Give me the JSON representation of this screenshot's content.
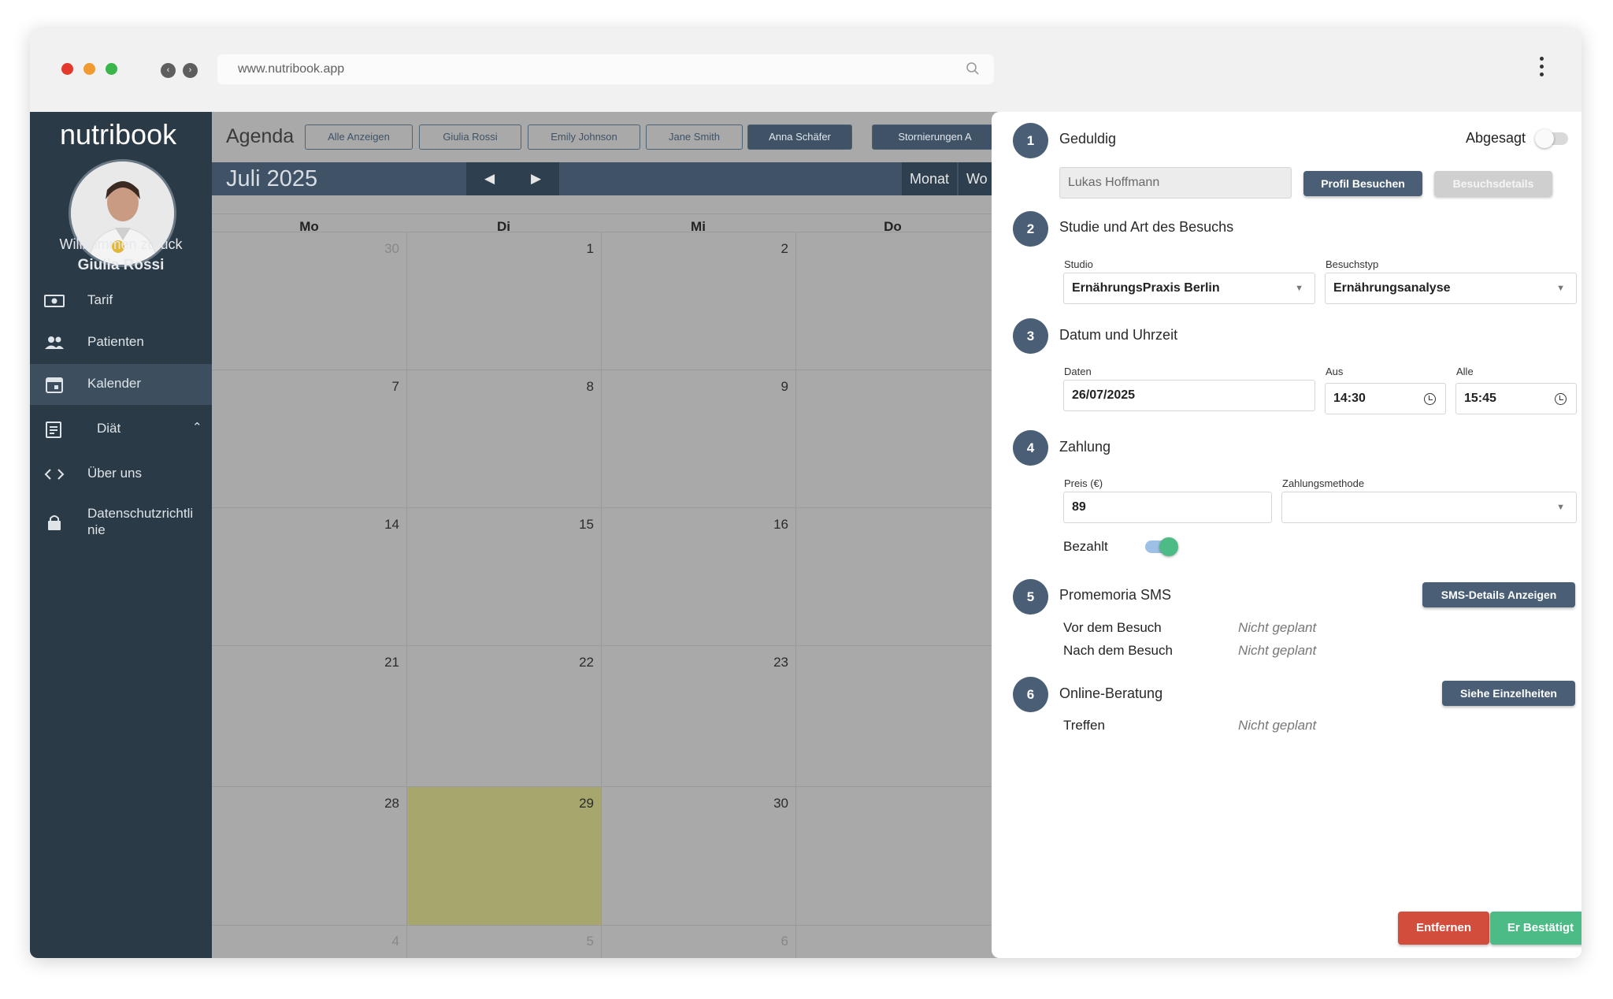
{
  "browser": {
    "url": "www.nutribook.app",
    "dot_colors": [
      "#e5382d",
      "#f19a2f",
      "#39b54a"
    ]
  },
  "sidebar": {
    "logo": "nutribook",
    "welcome_line1": "Willkommen zurück",
    "welcome_line2": "Giulia Rossi",
    "items": [
      {
        "label": "Tarif",
        "icon": "money-icon"
      },
      {
        "label": "Patienten",
        "icon": "people-icon"
      },
      {
        "label": "Kalender",
        "icon": "calendar-icon",
        "active": true
      },
      {
        "label": "Diät",
        "icon": "list-icon"
      },
      {
        "label": "Über uns",
        "icon": "code-icon"
      },
      {
        "label": "Datenschutzrichtlinie",
        "label_line1": "Datenschutzrichtli",
        "label_line2": "nie",
        "icon": "lock-icon"
      }
    ]
  },
  "calendar": {
    "title": "Agenda",
    "filters": [
      "Alle Anzeigen",
      "Giulia Rossi",
      "Emily Johnson",
      "Jane Smith",
      "Anna Schäfer",
      "Stornierungen A"
    ],
    "active_filter": "Anna Schäfer",
    "month": "Juli 2025",
    "views": [
      "Monat",
      "Wo"
    ],
    "weekdays": [
      "Mo",
      "Di",
      "Mi",
      "Do"
    ],
    "weeks": [
      [
        "30",
        "1",
        "2"
      ],
      [
        "7",
        "8",
        "9"
      ],
      [
        "14",
        "15",
        "16"
      ],
      [
        "21",
        "22",
        "23"
      ],
      [
        "28",
        "29",
        "30"
      ],
      [
        "4",
        "5",
        "6"
      ]
    ],
    "highlighted_day": "29",
    "highlight_color": "#a7a66c"
  },
  "panel": {
    "sections": {
      "s1": {
        "num": "1",
        "title": "Geduldig",
        "cancel_label": "Abgesagt",
        "cancelled": false,
        "patient": "Lukas Hoffmann",
        "profile_button": "Profil Besuchen",
        "details_button": "Besuchsdetails"
      },
      "s2": {
        "num": "2",
        "title": "Studie und Art des Besuchs",
        "studio_label": "Studio",
        "studio_value": "ErnährungsPraxis Berlin",
        "type_label": "Besuchstyp",
        "type_value": "Ernährungsanalyse"
      },
      "s3": {
        "num": "3",
        "title": "Datum und Uhrzeit",
        "date_label": "Daten",
        "date_value": "26/07/2025",
        "from_label": "Aus",
        "from_value": "14:30",
        "to_label": "Alle",
        "to_value": "15:45"
      },
      "s4": {
        "num": "4",
        "title": "Zahlung",
        "price_label": "Preis (€)",
        "price_value": "89",
        "method_label": "Zahlungsmethode",
        "method_value": "",
        "paid_label": "Bezahlt",
        "paid": true
      },
      "s5": {
        "num": "5",
        "title": "Promemoria SMS",
        "button": "SMS-Details Anzeigen",
        "before_label": "Vor dem Besuch",
        "before_value": "Nicht geplant",
        "after_label": "Nach dem Besuch",
        "after_value": "Nicht geplant"
      },
      "s6": {
        "num": "6",
        "title": "Online-Beratung",
        "button": "Siehe Einzelheiten",
        "meeting_label": "Treffen",
        "meeting_value": "Nicht geplant"
      }
    },
    "remove_button": "Entfernen",
    "confirm_button": "Er Bestätigt",
    "colors": {
      "primary": "#4a5f75",
      "danger": "#d34d3d",
      "success": "#4cbb85"
    }
  }
}
